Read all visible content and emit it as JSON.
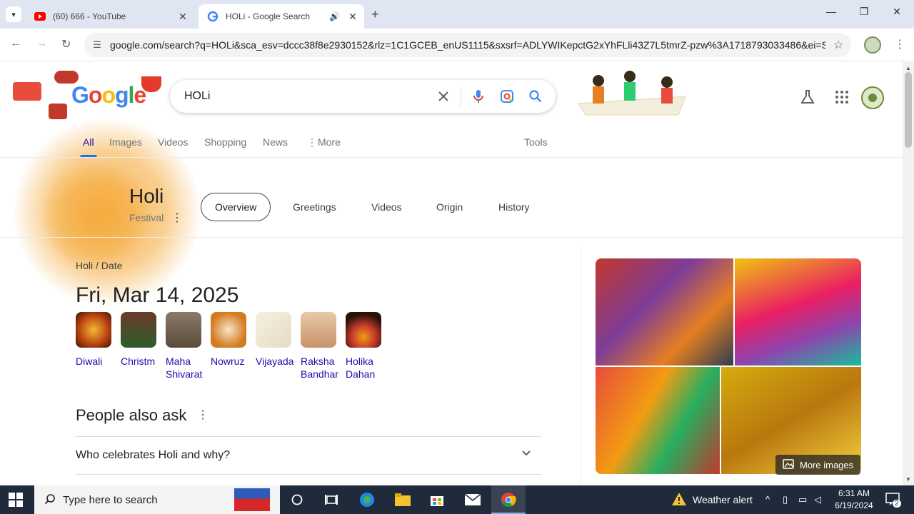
{
  "browser": {
    "tabs": [
      {
        "title": "(60) 666 - YouTube",
        "favicon": "youtube-icon",
        "active": false
      },
      {
        "title": "HOLi - Google Search",
        "favicon": "google-icon",
        "active": true
      }
    ],
    "url": "google.com/search?q=HOLi&sca_esv=dccc38f8e2930152&rlz=1C1GCEB_enUS1115&sxsrf=ADLYWIKepctG2xYhFLli43Z7L5tmrZ-pzw%3A1718793033486&ei=Sb..."
  },
  "search": {
    "query": "HOLi",
    "logo_text": [
      "G",
      "o",
      "o",
      "g",
      "l",
      "e"
    ],
    "tabs": [
      "All",
      "Images",
      "Videos",
      "Shopping",
      "News",
      "More"
    ],
    "tools_label": "Tools"
  },
  "knowledge": {
    "title": "Holi",
    "subtitle": "Festival",
    "chips": [
      "Overview",
      "Greetings",
      "Videos",
      "Origin",
      "History"
    ],
    "breadcrumb": [
      "Holi",
      "Date"
    ],
    "date": "Fri, Mar 14, 2025",
    "related": [
      {
        "label": "Diwali",
        "color": "#b5400f"
      },
      {
        "label": "Christm",
        "color": "#6b3a2a"
      },
      {
        "label": "Maha Shivarat",
        "color": "#5a4a3a"
      },
      {
        "label": "Nowruz",
        "color": "#d47a1f"
      },
      {
        "label": "Vijayada",
        "color": "#e6dcc4"
      },
      {
        "label": "Raksha Bandhar",
        "color": "#c8926a"
      },
      {
        "label": "Holika Dahan",
        "color": "#2a1206"
      }
    ],
    "images_more_label": "More images"
  },
  "paa": {
    "heading": "People also ask",
    "questions": [
      "Who celebrates Holi and why?"
    ]
  },
  "taskbar": {
    "search_placeholder": "Type here to search",
    "weather": "Weather alert",
    "time": "6:31 AM",
    "date": "6/19/2024",
    "notifications": "2"
  }
}
